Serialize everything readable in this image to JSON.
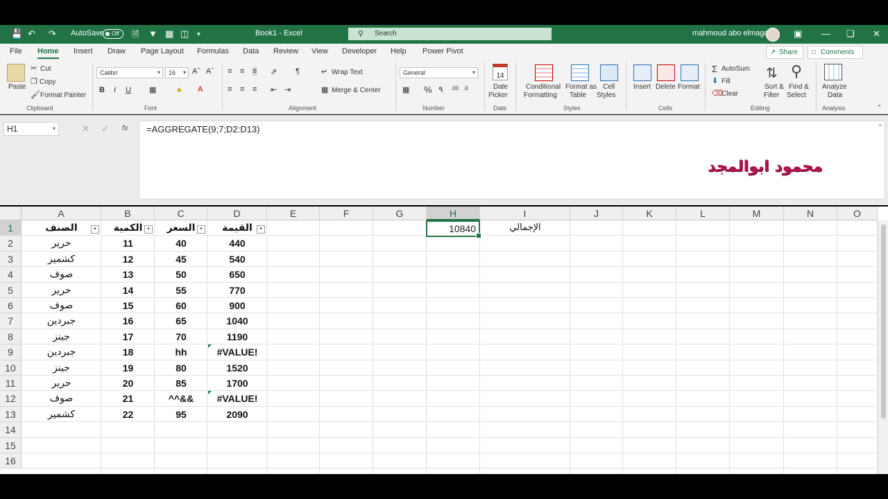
{
  "titlebar": {
    "autosave_label": "AutoSave",
    "autosave_state": "Off",
    "doc_title": "Book1  -  Excel",
    "search_placeholder": "Search",
    "user_name": "mahmoud abo elmagd"
  },
  "menu": {
    "tabs": [
      "File",
      "Home",
      "Insert",
      "Draw",
      "Page Layout",
      "Formulas",
      "Data",
      "Review",
      "View",
      "Developer",
      "Help",
      "Power Pivot"
    ],
    "active": "Home",
    "share": "Share",
    "comments": "Comments"
  },
  "ribbon": {
    "clipboard": {
      "paste": "Paste",
      "cut": "Cut",
      "copy": "Copy",
      "format_painter": "Format Painter",
      "label": "Clipboard"
    },
    "font": {
      "family": "Calibri",
      "size": "16",
      "bold": "B",
      "italic": "I",
      "underline": "U",
      "label": "Font"
    },
    "alignment": {
      "wrap": "Wrap Text",
      "merge": "Merge & Center",
      "label": "Alignment"
    },
    "number": {
      "format": "General",
      "label": "Number"
    },
    "date": {
      "picker_1": "Date",
      "picker_2": "Picker",
      "calendar_num": "14",
      "label": "Date"
    },
    "styles": {
      "cond_1": "Conditional",
      "cond_2": "Formatting",
      "table_1": "Format as",
      "table_2": "Table",
      "cell_1": "Cell",
      "cell_2": "Styles",
      "label": "Styles"
    },
    "cells": {
      "insert": "Insert",
      "delete": "Delete",
      "format": "Format",
      "label": "Cells"
    },
    "editing": {
      "autosum": "AutoSum",
      "fill": "Fill",
      "clear": "Clear",
      "sort_1": "Sort &",
      "sort_2": "Filter",
      "find_1": "Find &",
      "find_2": "Select",
      "label": "Editing"
    },
    "analysis": {
      "analyze_1": "Analyze",
      "analyze_2": "Data",
      "label": "Analysis"
    }
  },
  "formula_bar": {
    "name_box": "H1",
    "formula": "=AGGREGATE(9;7;D2:D13)",
    "fx": "fx"
  },
  "watermark": "محمود ابوالمجد",
  "grid": {
    "columns": [
      "A",
      "B",
      "C",
      "D",
      "E",
      "F",
      "G",
      "H",
      "I",
      "J",
      "K",
      "L",
      "M",
      "N",
      "O"
    ],
    "selected_column": "H",
    "rows": [
      "1",
      "2",
      "3",
      "4",
      "5",
      "6",
      "7",
      "8",
      "9",
      "10",
      "11",
      "12",
      "13",
      "14",
      "15",
      "16"
    ],
    "headers": {
      "a": "الصنف",
      "b": "الكمية",
      "c": "السعر",
      "d": "القيمة"
    },
    "data": [
      [
        "حرير",
        "11",
        "40",
        "440"
      ],
      [
        "كشمير",
        "12",
        "45",
        "540"
      ],
      [
        "صوف",
        "13",
        "50",
        "650"
      ],
      [
        "حرير",
        "14",
        "55",
        "770"
      ],
      [
        "صوف",
        "15",
        "60",
        "900"
      ],
      [
        "جبردين",
        "16",
        "65",
        "1040"
      ],
      [
        "جينز",
        "17",
        "70",
        "1190"
      ],
      [
        "جبردين",
        "18",
        "hh",
        "#VALUE!"
      ],
      [
        "جينز",
        "19",
        "80",
        "1520"
      ],
      [
        "حرير",
        "20",
        "85",
        "1700"
      ],
      [
        "صوف",
        "21",
        "^^&&",
        "#VALUE!"
      ],
      [
        "كشمير",
        "22",
        "95",
        "2090"
      ]
    ],
    "h1_value": "10840",
    "i1_label": "الإجمالي"
  }
}
